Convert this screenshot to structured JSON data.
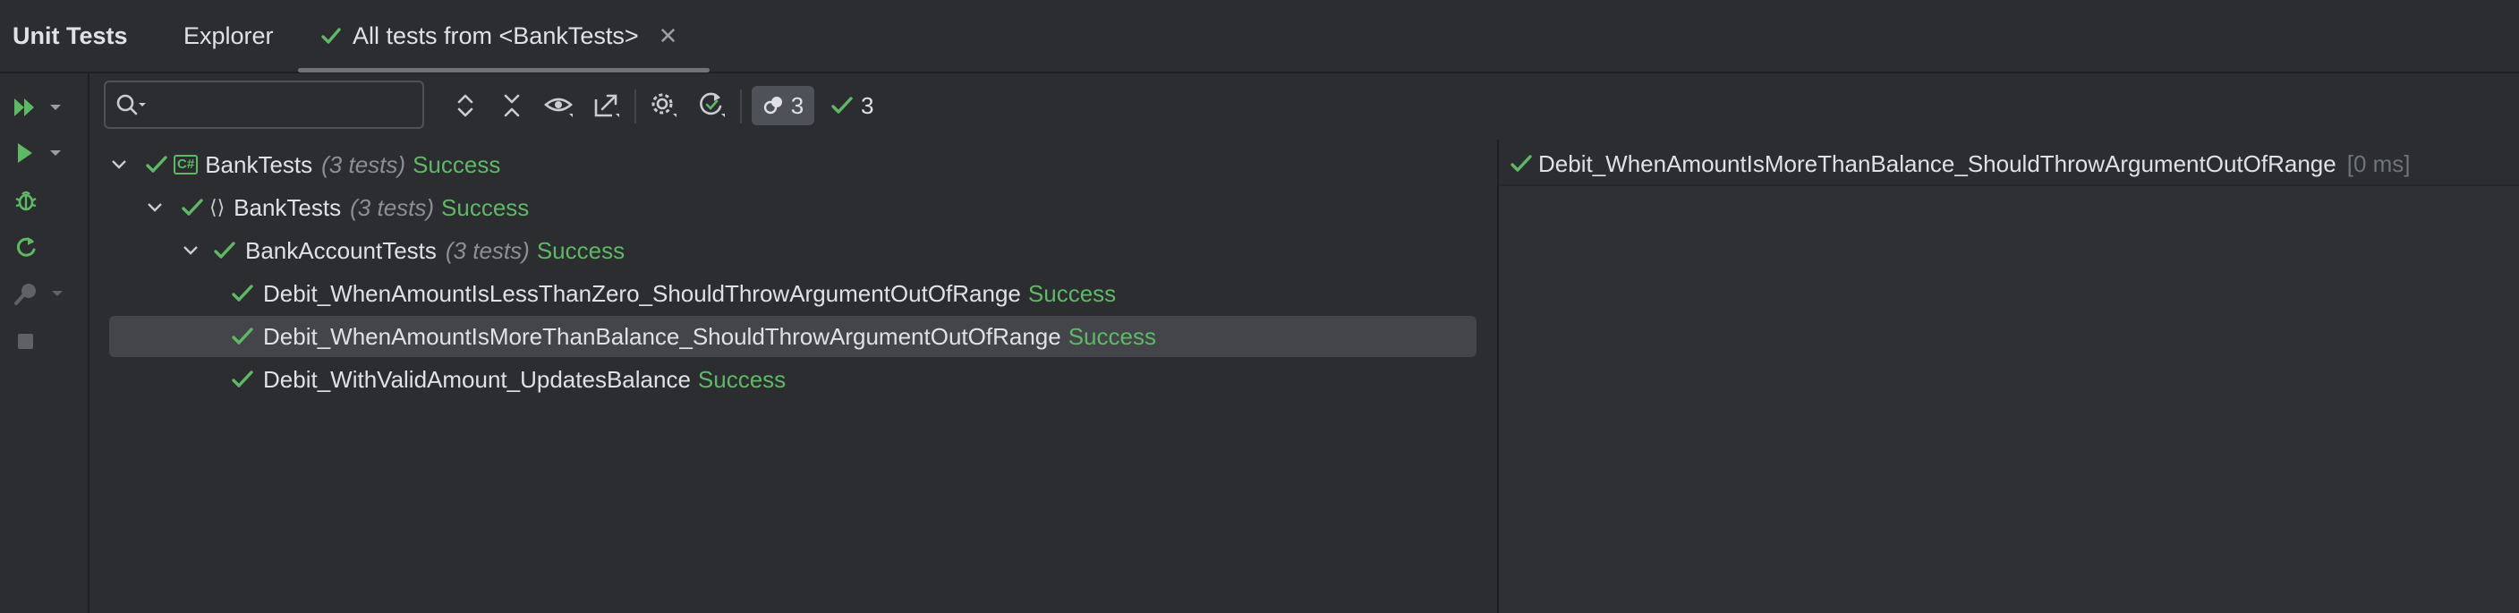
{
  "tabs": {
    "title": "Unit Tests",
    "explorer": "Explorer",
    "session": "All tests from <BankTests>",
    "close_symbol": "✕"
  },
  "toolbar": {
    "search_placeholder": "",
    "search_value": "",
    "filter_count": "3",
    "passed_count": "3"
  },
  "tree": {
    "root": {
      "name": "BankTests",
      "count": "(3 tests)",
      "status": "Success",
      "badge": "C#"
    },
    "namespace": {
      "name": "BankTests",
      "count": "(3 tests)",
      "status": "Success",
      "icon_text": "⟨⟩"
    },
    "class": {
      "name": "BankAccountTests",
      "count": "(3 tests)",
      "status": "Success"
    },
    "tests": [
      {
        "name": "Debit_WhenAmountIsLessThanZero_ShouldThrowArgumentOutOfRange",
        "status": "Success"
      },
      {
        "name": "Debit_WhenAmountIsMoreThanBalance_ShouldThrowArgumentOutOfRange",
        "status": "Success"
      },
      {
        "name": "Debit_WithValidAmount_UpdatesBalance",
        "status": "Success"
      }
    ]
  },
  "output": {
    "test_name": "Debit_WhenAmountIsMoreThanBalance_ShouldThrowArgumentOutOfRange",
    "duration": "[0 ms]"
  },
  "colors": {
    "success": "#5fb865",
    "background": "#2b2d30",
    "selected_row": "#43454a",
    "text": "#dfe1e5",
    "muted": "#8c8f95"
  },
  "icons": {
    "left_strip": [
      "run-all-icon",
      "run-icon",
      "debug-icon",
      "rerun-icon",
      "profile-icon",
      "stop-icon"
    ],
    "toolbar": [
      "search-icon",
      "expand-all-icon",
      "collapse-all-icon",
      "show-icon",
      "export-icon",
      "settings-icon",
      "auto-test-icon",
      "filter-icon",
      "check-icon"
    ]
  }
}
